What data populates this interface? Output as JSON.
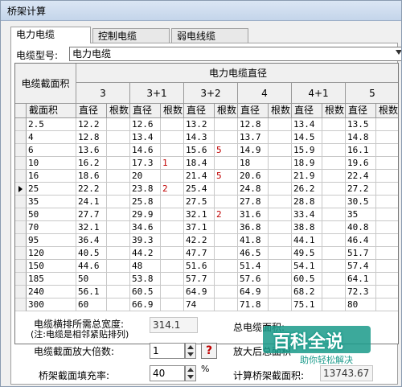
{
  "window": {
    "title": "桥架计算"
  },
  "tabs": [
    {
      "label": "电力电缆",
      "active": true
    },
    {
      "label": "控制电缆",
      "active": false
    },
    {
      "label": "弱电线缆",
      "active": false
    }
  ],
  "cable_type": {
    "label": "电缆型号:",
    "value": "电力电缆"
  },
  "grid": {
    "left_header": "电缆截面积",
    "main_header": "电力电缆直径",
    "groups": [
      "3",
      "3+1",
      "3+2",
      "4",
      "4+1",
      "5"
    ],
    "subheaders": [
      "截面积",
      "直径",
      "根数",
      "直径",
      "根数",
      "直径",
      "根数",
      "直径",
      "根数",
      "直径",
      "根数",
      "直径",
      "根数"
    ],
    "current_row": 5,
    "rows": [
      [
        "2.5",
        "12.2",
        "",
        "12.6",
        "",
        "13.2",
        "",
        "12.8",
        "",
        "13.4",
        "",
        "13.5",
        ""
      ],
      [
        "4",
        "12.8",
        "",
        "13.4",
        "",
        "14.3",
        "",
        "13.7",
        "",
        "14.5",
        "",
        "14.8",
        ""
      ],
      [
        "6",
        "13.6",
        "",
        "14.6",
        "",
        "15.6",
        "5",
        "14.9",
        "",
        "15.9",
        "",
        "16.1",
        ""
      ],
      [
        "10",
        "16.2",
        "",
        "17.3",
        "1",
        "18.4",
        "",
        "18",
        "",
        "18.9",
        "",
        "19.6",
        ""
      ],
      [
        "16",
        "18.6",
        "",
        "20",
        "",
        "21.4",
        "5",
        "20.6",
        "",
        "21.9",
        "",
        "22.4",
        ""
      ],
      [
        "25",
        "22.2",
        "",
        "23.8",
        "2",
        "25.4",
        "",
        "24.8",
        "",
        "26.2",
        "",
        "27.2",
        ""
      ],
      [
        "35",
        "24.1",
        "",
        "25.8",
        "",
        "27.5",
        "",
        "27.8",
        "",
        "28.8",
        "",
        "30.5",
        ""
      ],
      [
        "50",
        "27.7",
        "",
        "29.9",
        "",
        "32.1",
        "2",
        "31.6",
        "",
        "33.4",
        "",
        "35",
        ""
      ],
      [
        "70",
        "32.1",
        "",
        "34.6",
        "",
        "37.1",
        "",
        "36.8",
        "",
        "38.8",
        "",
        "40.8",
        ""
      ],
      [
        "95",
        "36.4",
        "",
        "39.3",
        "",
        "42.2",
        "",
        "41.8",
        "",
        "44.1",
        "",
        "46.4",
        ""
      ],
      [
        "120",
        "40.5",
        "",
        "44.2",
        "",
        "47.7",
        "",
        "46.5",
        "",
        "49.5",
        "",
        "51.7",
        ""
      ],
      [
        "150",
        "44.6",
        "",
        "48",
        "",
        "51.6",
        "",
        "51.4",
        "",
        "54.1",
        "",
        "57.4",
        ""
      ],
      [
        "185",
        "50",
        "",
        "53.8",
        "",
        "57.7",
        "",
        "57.6",
        "",
        "60.5",
        "",
        "64.1",
        ""
      ],
      [
        "240",
        "56.1",
        "",
        "60.5",
        "",
        "64.9",
        "",
        "64.9",
        "",
        "68.2",
        "",
        "72.3",
        ""
      ],
      [
        "300",
        "60",
        "",
        "66.9",
        "",
        "74",
        "",
        "71.8",
        "",
        "75.1",
        "",
        "80",
        ""
      ]
    ]
  },
  "form": {
    "width_label_1": "电缆横排所需总宽度:",
    "width_label_2": "(注:电缆是相邻紧贴排列)",
    "width_value": "314.1",
    "total_area_label": "总电缆面积:",
    "multiplier_label": "电缆截面放大倍数:",
    "multiplier_value": "1",
    "help_label": "?",
    "after_area_label": "放大后总面积",
    "fill_label": "桥架截面填充率:",
    "fill_value": "40",
    "fill_unit": "%",
    "tray_area_label": "计算桥架截面积:",
    "tray_area_value": "13743.67"
  },
  "watermark": {
    "brand": "百科全说",
    "sub": "助你轻松解决"
  },
  "colors": {
    "accent_red": "#c00000",
    "watermark_teal": "#1a9a8a"
  }
}
